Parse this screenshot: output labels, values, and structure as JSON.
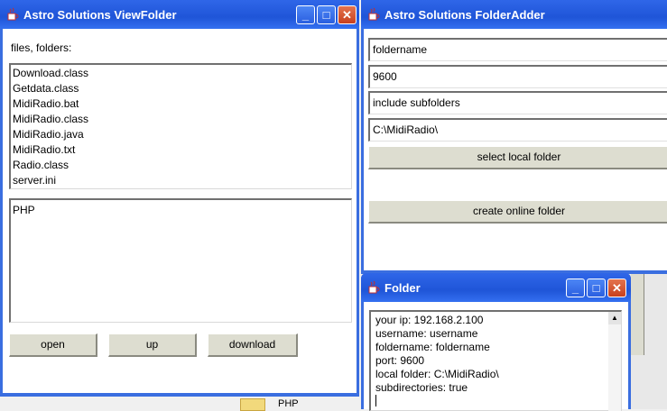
{
  "viewfolder": {
    "title": "Astro Solutions ViewFolder",
    "label": "files, folders:",
    "files": [
      "Download.class",
      "Getdata.class",
      "MidiRadio.bat",
      "MidiRadio.class",
      "MidiRadio.java",
      "MidiRadio.txt",
      "Radio.class",
      "server.ini"
    ],
    "text_area": "PHP",
    "buttons": {
      "open": "open",
      "up": "up",
      "download": "download"
    }
  },
  "folderadder": {
    "title": "Astro Solutions FolderAdder",
    "fields": {
      "foldername": "foldername",
      "port": "9600",
      "subfolders": "include subfolders",
      "local_folder": "C:\\MidiRadio\\"
    },
    "buttons": {
      "select": "select local folder",
      "create": "create online folder"
    }
  },
  "folder": {
    "title": "Folder",
    "lines": [
      "your ip: 192.168.2.100",
      "username: username",
      "foldername: foldername",
      "port: 9600",
      "local folder: C:\\MidiRadio\\",
      "subdirectories: true"
    ]
  },
  "background": {
    "partial_text": "PHP"
  },
  "colors": {
    "titlebar": "#2456e0",
    "close_button": "#d0512a",
    "button_face": "#ddddd0"
  },
  "icons": {
    "app": "java-cup-icon",
    "minimize": "minimize-icon",
    "maximize": "maximize-icon",
    "close": "close-icon"
  }
}
